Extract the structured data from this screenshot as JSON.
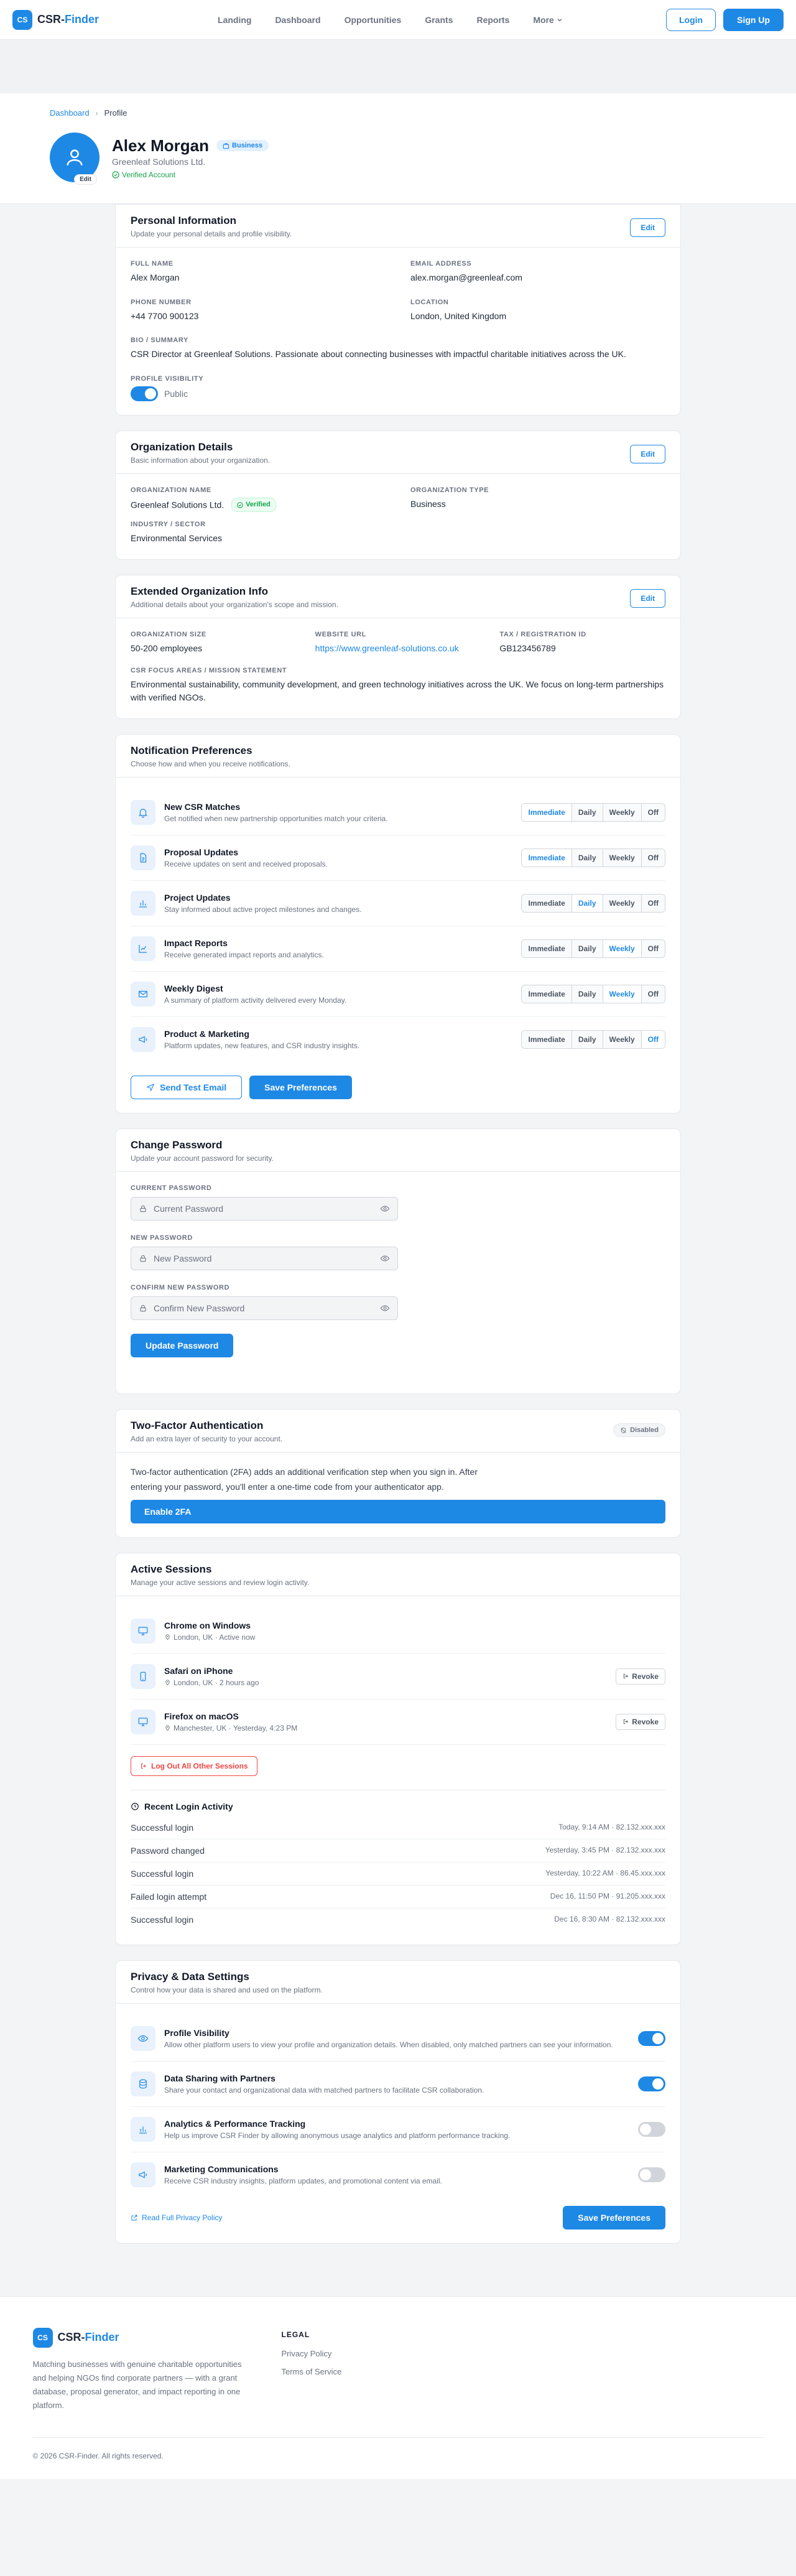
{
  "nav": {
    "brand_mark": "CS",
    "brand_part1": "CSR-",
    "brand_part2": "Finder",
    "links": [
      "Landing",
      "Dashboard",
      "Opportunities",
      "Grants",
      "Reports",
      "More"
    ],
    "login": "Login",
    "signup": "Sign Up"
  },
  "breadcrumb": {
    "home": "Dashboard",
    "current": "Profile"
  },
  "profile": {
    "name": "Alex Morgan",
    "role_badge": "Business",
    "organization": "Greenleaf Solutions Ltd.",
    "verified": "Verified Account",
    "avatar_edit": "Edit"
  },
  "personal": {
    "title": "Personal Information",
    "subtitle": "Update your personal details and profile visibility.",
    "edit": "Edit",
    "full_name_label": "Full Name",
    "full_name": "Alex Morgan",
    "email_label": "Email Address",
    "email": "alex.morgan@greenleaf.com",
    "phone_label": "Phone Number",
    "phone": "+44 7700 900123",
    "location_label": "Location",
    "location": "London, United Kingdom",
    "bio_label": "Bio / Summary",
    "bio": "CSR Director at Greenleaf Solutions. Passionate about connecting businesses with impactful charitable initiatives across the UK.",
    "visibility_label": "Profile Visibility",
    "visibility": "Public"
  },
  "org": {
    "title": "Organization Details",
    "subtitle": "Basic information about your organization.",
    "edit": "Edit",
    "name_label": "Organization Name",
    "name": "Greenleaf Solutions Ltd.",
    "verified": "Verified",
    "type_label": "Organization Type",
    "type": "Business",
    "industry_label": "Industry / Sector",
    "industry": "Environmental Services"
  },
  "ext": {
    "title": "Extended Organization Info",
    "subtitle": "Additional details about your organization's scope and mission.",
    "edit": "Edit",
    "size_label": "Organization Size",
    "size": "50-200 employees",
    "website_label": "Website URL",
    "website": "https://www.greenleaf-solutions.co.uk",
    "tax_label": "Tax / Registration ID",
    "tax": "GB123456789",
    "focus_label": "CSR Focus Areas / Mission Statement",
    "focus": "Environmental sustainability, community development, and green technology initiatives across the UK. We focus on long-term partnerships with verified NGOs."
  },
  "notifications": {
    "title": "Notification Preferences",
    "subtitle": "Choose how and when you receive notifications.",
    "options": [
      "Immediate",
      "Daily",
      "Weekly",
      "Off"
    ],
    "items": [
      {
        "title": "New CSR Matches",
        "desc": "Get notified when new partnership opportunities match your criteria.",
        "selected": "Immediate"
      },
      {
        "title": "Proposal Updates",
        "desc": "Receive updates on sent and received proposals.",
        "selected": "Immediate"
      },
      {
        "title": "Project Updates",
        "desc": "Stay informed about active project milestones and changes.",
        "selected": "Daily"
      },
      {
        "title": "Impact Reports",
        "desc": "Receive generated impact reports and analytics.",
        "selected": "Weekly"
      },
      {
        "title": "Weekly Digest",
        "desc": "A summary of platform activity delivered every Monday.",
        "selected": "Weekly"
      },
      {
        "title": "Product & Marketing",
        "desc": "Platform updates, new features, and CSR industry insights.",
        "selected": "Off"
      }
    ],
    "test_email": "Send Test Email",
    "save": "Save Preferences"
  },
  "password": {
    "title": "Change Password",
    "subtitle": "Update your account password for security.",
    "current_label": "Current Password",
    "current_placeholder": "Current Password",
    "new_label": "New Password",
    "new_placeholder": "New Password",
    "confirm_label": "Confirm New Password",
    "confirm_placeholder": "Confirm New Password",
    "submit": "Update Password"
  },
  "twofa": {
    "title": "Two-Factor Authentication",
    "subtitle": "Add an extra layer of security to your account.",
    "status": "Disabled",
    "text": "Two-factor authentication (2FA) adds an additional verification step when you sign in. After entering your password, you'll enter a one-time code from your authenticator app.",
    "enable": "Enable 2FA"
  },
  "sessions": {
    "title": "Active Sessions",
    "subtitle": "Manage your active sessions and review login activity.",
    "items": [
      {
        "device": "Chrome on Windows",
        "meta": "London, UK · Active now",
        "revoke": ""
      },
      {
        "device": "Safari on iPhone",
        "meta": "London, UK · 2 hours ago",
        "revoke": "Revoke"
      },
      {
        "device": "Firefox on macOS",
        "meta": "Manchester, UK · Yesterday, 4:23 PM",
        "revoke": "Revoke"
      }
    ],
    "logout_all": "Log Out All Other Sessions",
    "activity_title": "Recent Login Activity",
    "activity": [
      {
        "event": "Successful login",
        "meta": "Today, 9:14 AM · 82.132.xxx.xxx"
      },
      {
        "event": "Password changed",
        "meta": "Yesterday, 3:45 PM · 82.132.xxx.xxx"
      },
      {
        "event": "Successful login",
        "meta": "Yesterday, 10:22 AM · 86.45.xxx.xxx"
      },
      {
        "event": "Failed login attempt",
        "meta": "Dec 16, 11:50 PM · 91.205.xxx.xxx"
      },
      {
        "event": "Successful login",
        "meta": "Dec 16, 8:30 AM · 82.132.xxx.xxx"
      }
    ]
  },
  "privacy": {
    "title": "Privacy & Data Settings",
    "subtitle": "Control how your data is shared and used on the platform.",
    "items": [
      {
        "title": "Profile Visibility",
        "desc": "Allow other platform users to view your profile and organization details. When disabled, only matched partners can see your information.",
        "on": true
      },
      {
        "title": "Data Sharing with Partners",
        "desc": "Share your contact and organizational data with matched partners to facilitate CSR collaboration.",
        "on": true
      },
      {
        "title": "Analytics & Performance Tracking",
        "desc": "Help us improve CSR Finder by allowing anonymous usage analytics and platform performance tracking.",
        "on": false
      },
      {
        "title": "Marketing Communications",
        "desc": "Receive CSR industry insights, platform updates, and promotional content via email.",
        "on": false
      }
    ],
    "policy_link": "Read Full Privacy Policy",
    "save": "Save Preferences"
  },
  "footer": {
    "description": "Matching businesses with genuine charitable opportunities and helping NGOs find corporate partners — with a grant database, proposal generator, and impact reporting in one platform.",
    "legal_heading": "LEGAL",
    "privacy_policy": "Privacy Policy",
    "terms": "Terms of Service",
    "copyright": "© 2026 CSR-Finder. All rights reserved."
  },
  "colors": {
    "primary": "#1e88e5",
    "success": "#16a34a",
    "danger": "#ef4444"
  }
}
